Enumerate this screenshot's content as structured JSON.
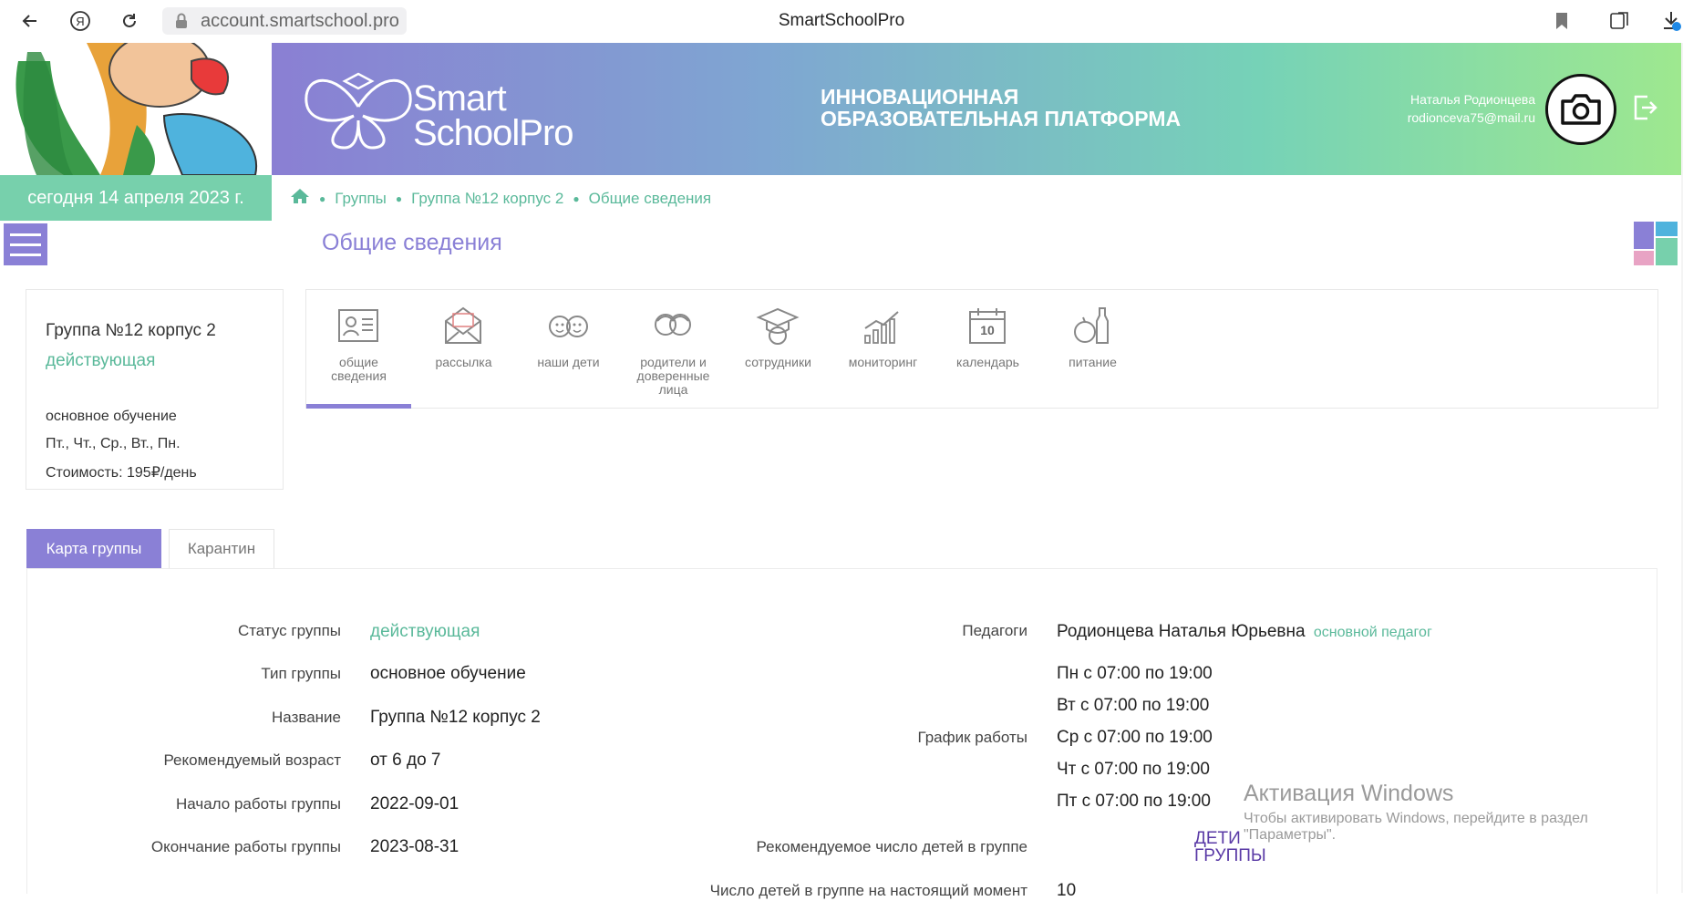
{
  "browser": {
    "url": "account.smartschool.pro",
    "tab_title": "SmartSchoolPro"
  },
  "header": {
    "brand_line1": "Smart",
    "brand_line2": "SchoolPro",
    "slogan_line1": "ИННОВАЦИОННАЯ",
    "slogan_line2": "ОБРАЗОВАТЕЛЬНАЯ ПЛАТФОРМА",
    "user_name": "Наталья Родионцева",
    "user_email": "rodionceva75@mail.ru"
  },
  "date_bar": "сегодня 14 апреля 2023 г.",
  "breadcrumb": [
    "Группы",
    "Группа №12 корпус 2",
    "Общие сведения"
  ],
  "page_title": "Общие сведения",
  "info_card": {
    "name": "Группа №12 корпус 2",
    "status": "действующая",
    "type": "основное обучение",
    "days": "Пт., Чт., Ср., Вт., Пн.",
    "cost": "Стоимость: 195₽/день"
  },
  "icon_nav": [
    {
      "icon": "id-card-icon",
      "label1": "общие",
      "label2": "сведения",
      "label3": ""
    },
    {
      "icon": "envelope-icon",
      "label1": "рассылка",
      "label2": "",
      "label3": ""
    },
    {
      "icon": "kids-icon",
      "label1": "наши дети",
      "label2": "",
      "label3": ""
    },
    {
      "icon": "parents-icon",
      "label1": "родители и",
      "label2": "доверенные",
      "label3": "лица"
    },
    {
      "icon": "graduate-icon",
      "label1": "сотрудники",
      "label2": "",
      "label3": ""
    },
    {
      "icon": "chart-icon",
      "label1": "мониторинг",
      "label2": "",
      "label3": ""
    },
    {
      "icon": "calendar-icon",
      "label1": "календарь",
      "label2": "",
      "label3": ""
    },
    {
      "icon": "food-icon",
      "label1": "питание",
      "label2": "",
      "label3": ""
    }
  ],
  "calendar_day": "10",
  "tabs": {
    "map": "Карта группы",
    "quarantine": "Карантин"
  },
  "group_map": {
    "status_label": "Статус группы",
    "status_value": "действующая",
    "type_label": "Тип группы",
    "type_value": "основное обучение",
    "name_label": "Название",
    "name_value": "Группа №12 корпус 2",
    "age_label": "Рекомендуемый возраст",
    "age_value": "от 6 до 7",
    "start_label": "Начало работы группы",
    "start_value": "2022-09-01",
    "end_label": "Окончание работы группы",
    "end_value": "2023-08-31",
    "teachers_label": "Педагоги",
    "teacher_name": "Родионцева Наталья Юрьевна",
    "teacher_role": "основной педагог",
    "schedule_label": "График работы",
    "schedule": [
      "Пн с 07:00 по 19:00",
      "Вт с 07:00 по 19:00",
      "Ср с 07:00 по 19:00",
      "Чт с 07:00 по 19:00",
      "Пт с 07:00 по 19:00"
    ],
    "rec_children_label": "Рекомендуемое число детей в группе",
    "rec_children_link1": "ДЕТИ",
    "rec_children_link2": "ГРУППЫ",
    "current_children_label": "Число детей в группе на настоящий момент",
    "current_children_value": "10"
  },
  "watermark": {
    "title": "Активация Windows",
    "line1": "Чтобы активировать Windows, перейдите в раздел",
    "line2": "\"Параметры\"."
  }
}
